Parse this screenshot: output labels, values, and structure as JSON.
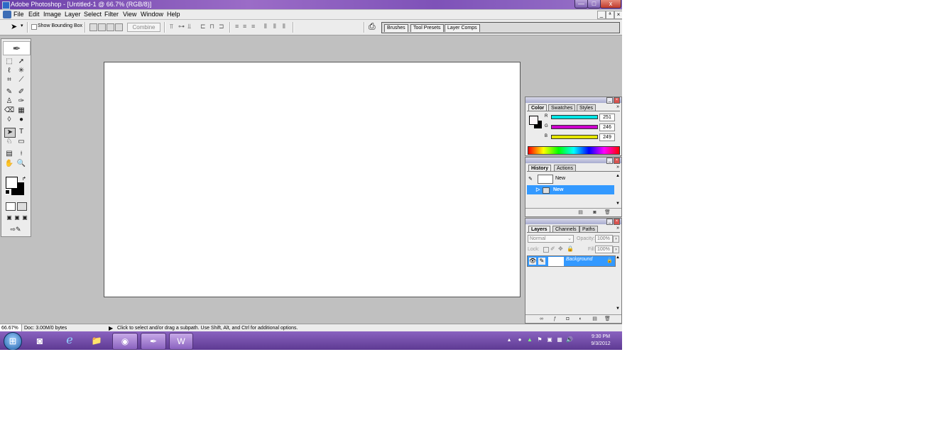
{
  "window": {
    "title": "Adobe Photoshop - [Untitled-1 @ 66.7% (RGB/8)]",
    "minimize_glyph": "—",
    "maximize_glyph": "□",
    "close_glyph": "x"
  },
  "menu": {
    "items": [
      "File",
      "Edit",
      "Image",
      "Layer",
      "Select",
      "Filter",
      "View",
      "Window",
      "Help"
    ],
    "doc_min_glyph": "_",
    "doc_restore_glyph": "ª",
    "doc_close_glyph": "×"
  },
  "options": {
    "show_bounding_box": "Show Bounding Box",
    "combine": "Combine",
    "well_tabs": [
      "Brushes",
      "Tool Presets",
      "Layer Comps"
    ]
  },
  "color_palette": {
    "tabs": [
      "Color",
      "Swatches",
      "Styles"
    ],
    "channels": [
      {
        "label": "R",
        "value": "251",
        "color": "#00e5e5"
      },
      {
        "label": "G",
        "value": "246",
        "color": "#cc00cc"
      },
      {
        "label": "B",
        "value": "249",
        "color": "#e5e500"
      }
    ]
  },
  "history_palette": {
    "tabs": [
      "History",
      "Actions"
    ],
    "snapshot_label": "New",
    "state_label": "New"
  },
  "layers_palette": {
    "tabs": [
      "Layers",
      "Channels",
      "Paths"
    ],
    "blend_mode": "Normal",
    "opacity_label": "Opacity:",
    "opacity_value": "100%",
    "lock_label": "Lock:",
    "fill_label": "Fill:",
    "fill_value": "100%",
    "layer_name": "Background"
  },
  "status": {
    "zoom": "66.67%",
    "doc_size": "Doc: 3.00M/0 bytes",
    "hint": "Click to select and/or drag a subpath.  Use Shift, Alt, and Ctrl for additional options."
  },
  "taskbar": {
    "time": "9:30 PM",
    "date": "9/3/2012"
  },
  "colors": {
    "selection_blue": "#3399ff",
    "taskbar_purple": "#6e48a8"
  }
}
